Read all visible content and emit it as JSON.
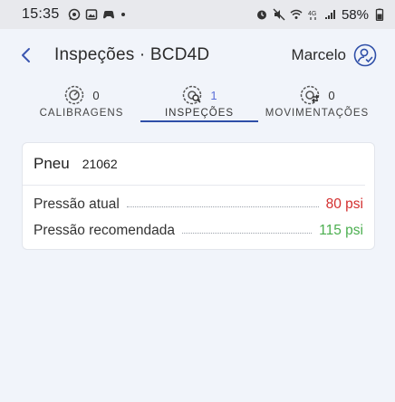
{
  "status_bar": {
    "time": "15:35",
    "battery": "58%",
    "icons": [
      "whatsapp-icon",
      "gallery-icon",
      "game-icon",
      "alarm-icon",
      "mute-icon",
      "wifi-icon",
      "4g-icon",
      "signal-icon",
      "battery-icon"
    ]
  },
  "appbar": {
    "title": "Inspeções · BCD4D",
    "user": "Marcelo"
  },
  "tabs": [
    {
      "label": "CALIBRAGENS",
      "count": "0",
      "active": false
    },
    {
      "label": "INSPEÇÕES",
      "count": "1",
      "active": true
    },
    {
      "label": "MOVIMENTAÇÕES",
      "count": "0",
      "active": false
    }
  ],
  "card": {
    "tire_label": "Pneu",
    "tire_number": "21062",
    "rows": [
      {
        "label": "Pressão atual",
        "value": "80 psi",
        "color": "#d32f2f"
      },
      {
        "label": "Pressão recomendada",
        "value": "115 psi",
        "color": "#4caf50"
      }
    ]
  },
  "colors": {
    "accent": "#2f4fa8",
    "background": "#f1f4fa"
  }
}
